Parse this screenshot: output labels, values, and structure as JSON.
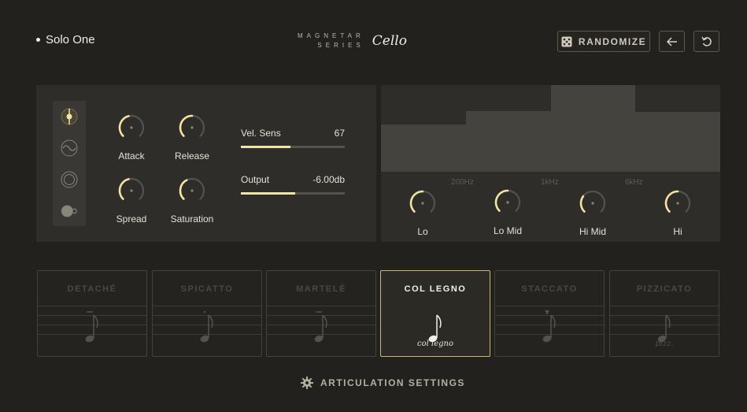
{
  "header": {
    "preset_name": "Solo One",
    "brand_series": "MAGNETAR SERIES",
    "brand_name": "Cello",
    "randomize_label": "RANDOMIZE"
  },
  "mode_icons": [
    "pin-icon",
    "waveform-icon",
    "target-icon",
    "toggle-icon"
  ],
  "knobs": [
    {
      "label": "Attack",
      "value": 0.45
    },
    {
      "label": "Release",
      "value": 0.5
    },
    {
      "label": "Spread",
      "value": 0.45
    },
    {
      "label": "Saturation",
      "value": 0.4
    }
  ],
  "sliders": [
    {
      "label": "Vel. Sens",
      "value_text": "67",
      "fraction": 0.48
    },
    {
      "label": "Output",
      "value_text": "-6.00db",
      "fraction": 0.52
    }
  ],
  "eq": {
    "frequency_labels": [
      "200Hz",
      "1kHz",
      "6kHz"
    ],
    "bands": [
      {
        "label": "Lo",
        "value": 0.5
      },
      {
        "label": "Lo Mid",
        "value": 0.5
      },
      {
        "label": "Hi Mid",
        "value": 0.3
      },
      {
        "label": "Hi",
        "value": 0.5
      }
    ],
    "band_levels": [
      0.55,
      0.7,
      1.0,
      0.69
    ]
  },
  "articulations": [
    {
      "title": "DETACHÉ",
      "sub": "",
      "active": false
    },
    {
      "title": "SPICATTO",
      "sub": "",
      "active": false
    },
    {
      "title": "MARTELÉ",
      "sub": "",
      "active": false
    },
    {
      "title": "COL LEGNO",
      "sub": "col legno",
      "active": true
    },
    {
      "title": "STACCATO",
      "sub": "",
      "active": false
    },
    {
      "title": "PIZZICATO",
      "sub": "pizz.",
      "active": false
    }
  ],
  "footer": {
    "settings_label": "ARTICULATION SETTINGS"
  },
  "colors": {
    "accent": "#f3e3a4",
    "background": "#23211e",
    "panel": "#2f2d2a"
  }
}
